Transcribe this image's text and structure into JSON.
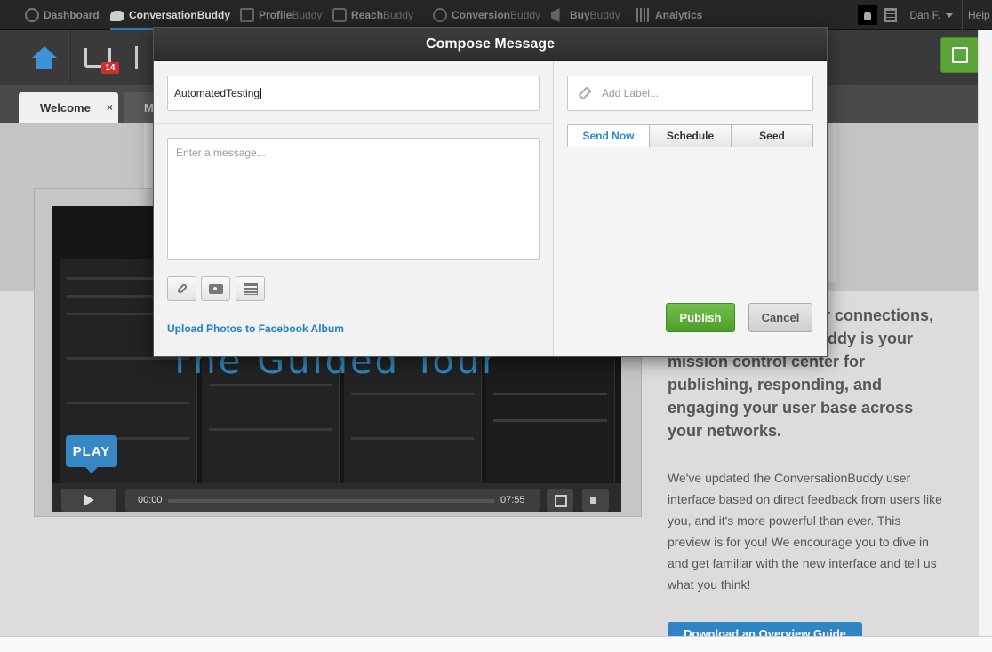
{
  "topnav": {
    "items": [
      {
        "label": "Dashboard",
        "icon": "dashboard-icon"
      },
      {
        "label": "Conversation",
        "suffix": "Buddy",
        "icon": "speech-bubble-icon",
        "active": true
      },
      {
        "label": "Profile",
        "suffix": "Buddy",
        "icon": "profile-icon"
      },
      {
        "label": "Reach",
        "suffix": "Buddy",
        "icon": "reach-icon"
      },
      {
        "label": "Conversion",
        "suffix": "Buddy",
        "icon": "conversion-icon"
      },
      {
        "label": "Buy",
        "suffix": "Buddy",
        "icon": "megaphone-icon"
      },
      {
        "label": "Analytics",
        "icon": "bar-chart-icon"
      }
    ],
    "user": "Dan F.",
    "help": "Help"
  },
  "toolbar": {
    "inbox_badge": "14"
  },
  "tabs": [
    {
      "label": "Welcome",
      "close": "×"
    },
    {
      "label": "M"
    }
  ],
  "background": {
    "video_title": "The Guided Tour",
    "play_label": "PLAY",
    "time_current": "00:00",
    "time_total": "07:55",
    "side_heading": "r connections, ddy is your mission control center for publishing, responding, and engaging your user base across your networks.",
    "side_heading_lines": [
      "r connections,",
      "ddy is your",
      "mission control center for",
      "publishing, responding, and",
      "engaging your user base across",
      "your networks."
    ],
    "side_paragraph": "We've updated the ConversationBuddy user interface based on direct feedback from users like you, and it's more powerful than ever. This preview is for you! We encourage you to dive in and get familiar with the new interface and tell us what you think!",
    "download_button": "Download an Overview Guide"
  },
  "modal": {
    "title": "Compose Message",
    "to_value": "AutomatedTesting",
    "message_placeholder": "Enter a message...",
    "label_placeholder": "Add Label...",
    "upload_link": "Upload Photos to Facebook Album",
    "modes": [
      "Send Now",
      "Schedule",
      "Seed"
    ],
    "active_mode": "Send Now",
    "publish": "Publish",
    "cancel": "Cancel"
  },
  "colors": {
    "accent": "#2a8ad2",
    "publish": "#5aa43a",
    "badge": "#c8312f"
  }
}
